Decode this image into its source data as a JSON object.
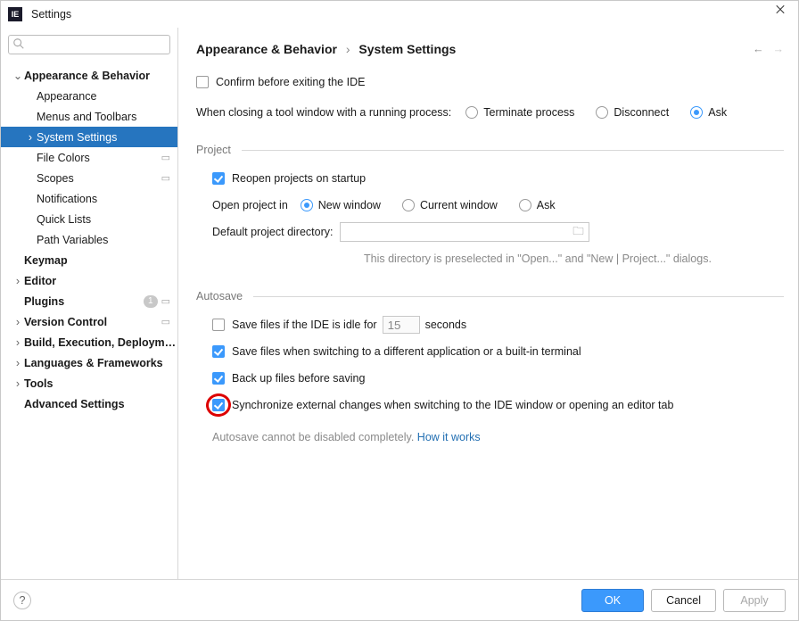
{
  "window": {
    "title": "Settings"
  },
  "search": {
    "placeholder": ""
  },
  "tree": {
    "appearance_behavior": "Appearance & Behavior",
    "appearance": "Appearance",
    "menus_toolbars": "Menus and Toolbars",
    "system_settings": "System Settings",
    "file_colors": "File Colors",
    "scopes": "Scopes",
    "notifications": "Notifications",
    "quick_lists": "Quick Lists",
    "path_variables": "Path Variables",
    "keymap": "Keymap",
    "editor": "Editor",
    "plugins": "Plugins",
    "plugins_badge": "1",
    "version_control": "Version Control",
    "build": "Build, Execution, Deployment",
    "lang_fw": "Languages & Frameworks",
    "tools": "Tools",
    "advanced": "Advanced Settings"
  },
  "breadcrumb": {
    "parent": "Appearance & Behavior",
    "current": "System Settings"
  },
  "general": {
    "confirm_exit": "Confirm before exiting the IDE",
    "closing_label": "When closing a tool window with a running process:",
    "terminate": "Terminate process",
    "disconnect": "Disconnect",
    "ask": "Ask"
  },
  "project": {
    "heading": "Project",
    "reopen": "Reopen projects on startup",
    "open_in_label": "Open project in",
    "new_window": "New window",
    "current_window": "Current window",
    "ask": "Ask",
    "default_dir_label": "Default project directory:",
    "default_dir_value": "",
    "hint": "This directory is preselected in \"Open...\" and \"New | Project...\" dialogs."
  },
  "autosave": {
    "heading": "Autosave",
    "idle_pre": "Save files if the IDE is idle for",
    "idle_val": "15",
    "idle_post": "seconds",
    "switch_app": "Save files when switching to a different application or a built-in terminal",
    "backup": "Back up files before saving",
    "sync": "Synchronize external changes when switching to the IDE window or opening an editor tab",
    "note": "Autosave cannot be disabled completely.",
    "how": "How it works"
  },
  "buttons": {
    "ok": "OK",
    "cancel": "Cancel",
    "apply": "Apply"
  },
  "state": {
    "confirm_exit": false,
    "close_action": "ask",
    "reopen": true,
    "open_in": "new_window",
    "idle_save": false,
    "switch_save": true,
    "backup": true,
    "sync": true
  }
}
